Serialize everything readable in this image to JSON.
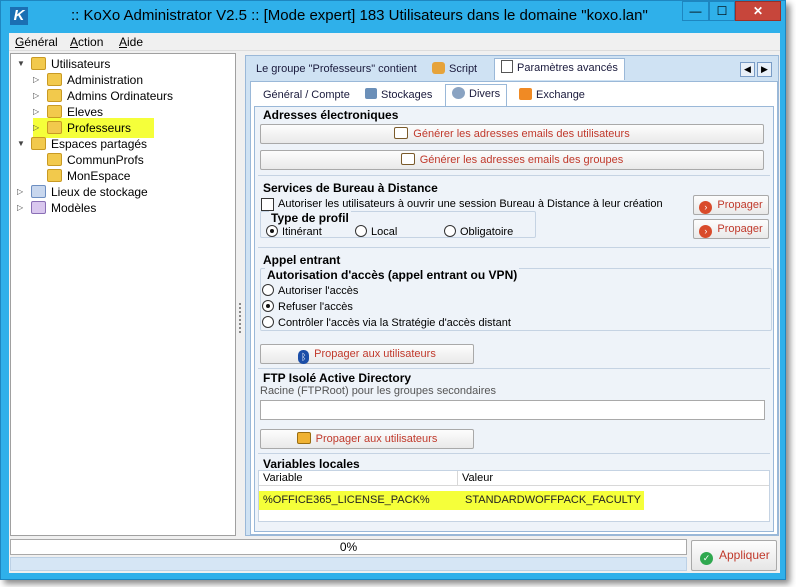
{
  "window": {
    "title": ":: KoXo Administrator V2.5 :: [Mode expert] 183 Utilisateurs dans le domaine \"koxo.lan\"",
    "app_icon": "K",
    "min_label": "—",
    "max_label": "☐",
    "close_label": "✕"
  },
  "menu": {
    "items": [
      {
        "prefix": "G",
        "rest": "énéral"
      },
      {
        "prefix": "A",
        "rest": "ction"
      },
      {
        "prefix": "A",
        "rest": "ide"
      }
    ]
  },
  "tree": {
    "items": [
      {
        "label": "Utilisateurs",
        "icon": "users-icon",
        "arrow": "▼"
      },
      {
        "label": "Administration",
        "icon": "folder-icon",
        "arrow": "▷"
      },
      {
        "label": "Admins Ordinateurs",
        "icon": "folder-icon",
        "arrow": "▷"
      },
      {
        "label": "Eleves",
        "icon": "folder-icon",
        "arrow": "▷"
      },
      {
        "label": "Professeurs",
        "icon": "folder-icon",
        "arrow": "▷",
        "selected": true
      },
      {
        "label": "Espaces partagés",
        "icon": "share-icon",
        "arrow": "▼"
      },
      {
        "label": "CommunProfs",
        "icon": "folder-icon",
        "arrow": ""
      },
      {
        "label": "MonEspace",
        "icon": "folder-icon",
        "arrow": ""
      },
      {
        "label": "Lieux de stockage",
        "icon": "storage-icon",
        "arrow": "▷"
      },
      {
        "label": "Modèles",
        "icon": "model-icon",
        "arrow": "▷"
      }
    ]
  },
  "tabs1": {
    "items": [
      "Le groupe \"Professeurs\" contient",
      "Script",
      "Paramètres avancés"
    ],
    "active": 2,
    "nav_left": "◀",
    "nav_right": "▶"
  },
  "tabs2": {
    "items": [
      "Général / Compte",
      "Stockages",
      "Divers",
      "Exchange"
    ],
    "active": 2
  },
  "email": {
    "title": "Adresses électroniques",
    "btn_users": "Générer les adresses emails des utilisateurs",
    "btn_groups": "Générer les adresses emails des groupes"
  },
  "rds": {
    "title": "Services de Bureau à Distance",
    "checkbox_label": "Autoriser les utilisateurs à ouvrir une session Bureau à Distance à leur création",
    "profile_title": "Type de profil",
    "profile_options": [
      "Itinérant",
      "Local",
      "Obligatoire"
    ],
    "profile_selected": 0,
    "propagate": "Propager"
  },
  "dialin": {
    "title": "Appel entrant",
    "subtitle": "Autorisation d'accès (appel entrant ou VPN)",
    "options": [
      "Autoriser l'accès",
      "Refuser l'accès",
      "Contrôler l'accès via la Stratégie d'accès distant"
    ],
    "selected": 1,
    "propagate": "Propager aux utilisateurs"
  },
  "ftp": {
    "title": "FTP Isolé Active Directory",
    "root_label": "Racine (FTPRoot) pour les groupes secondaires",
    "root_value": "",
    "propagate": "Propager aux utilisateurs"
  },
  "vars": {
    "title": "Variables locales",
    "col_var": "Variable",
    "col_val": "Valeur",
    "rows": [
      {
        "name": "%OFFICE365_LICENSE_PACK%",
        "value": "STANDARDWOFFPACK_FACULTY"
      }
    ]
  },
  "status": {
    "progress_percent": 0,
    "progress_text": "0%",
    "apply": "Appliquer"
  }
}
